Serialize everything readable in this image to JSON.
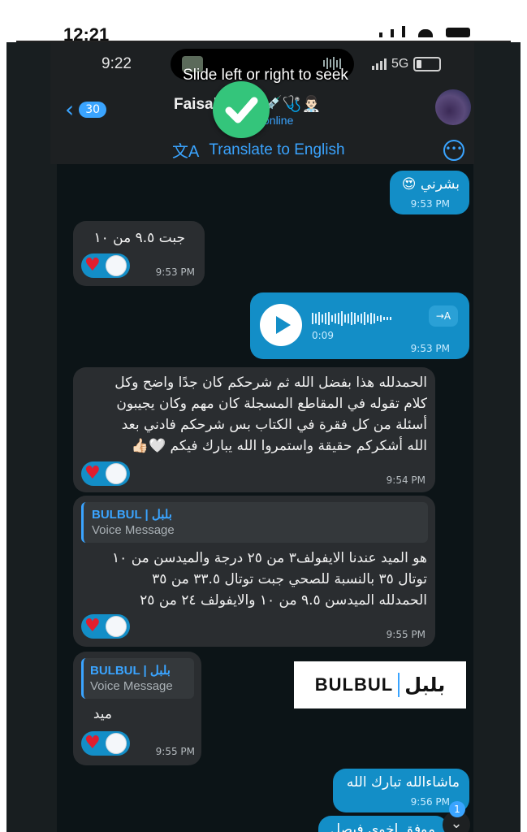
{
  "outer_status": {
    "time": "12:21"
  },
  "inner_status": {
    "time": "9:22",
    "network": "5G"
  },
  "overlay": {
    "seek_hint": "Slide left or right to seek"
  },
  "header": {
    "back_count": "30",
    "contact_name": "Faisal Aldai 💉🩺👨🏻‍⚕️",
    "contact_status": "online",
    "translate_label": "Translate to English"
  },
  "messages": [
    {
      "direction": "out",
      "text": "بشرني 😍",
      "time": "9:53 PM"
    },
    {
      "direction": "in",
      "text": "جبت ٩.٥ من ١٠",
      "time": "9:53 PM"
    },
    {
      "direction": "out",
      "type": "voice",
      "duration": "0:09",
      "transcribe_label": "→A",
      "time": "9:53 PM"
    },
    {
      "direction": "in",
      "lines": [
        "الحمدلله هذا بفضل الله ثم شرحكم كان جدًا واضح وكل",
        "كلام تقوله في المقاطع المسجلة كان مهم وكان يجيبون",
        "أسئلة من كل فقرة في الكتاب بس شرحكم فادني بعد",
        "الله أشكركم حقيقة واستمروا الله يبارك فيكم 🤍👍🏻"
      ],
      "time": "9:54 PM"
    },
    {
      "direction": "in",
      "reply_title": "BULBUL | بلبل",
      "reply_sub": "Voice Message",
      "lines": [
        "هو الميد عندنا الايفولف٣ من ٢٥ درجة والميدسن من ١٠",
        "توتال ٣٥ بالنسبة للصحي جبت توتال ٣٣.٥ من ٣٥",
        "الحمدلله الميدسن ٩.٥ من ١٠ والايفولف ٢٤ من ٢٥"
      ],
      "time": "9:55 PM"
    },
    {
      "direction": "in",
      "reply_title": "BULBUL | بلبل",
      "reply_sub": "Voice Message",
      "text": "ميد",
      "time": "9:55 PM"
    },
    {
      "direction": "out",
      "text": "ماشاءالله تبارك الله",
      "time": "9:56 PM"
    },
    {
      "direction": "out",
      "text": "موفق اخوي فيصل"
    }
  ],
  "brand": {
    "latin": "BULBUL",
    "arabic": "بلبل"
  },
  "scroll_badge": "1",
  "colors": {
    "accent": "#3aa4ff",
    "outgoing": "#138ec7",
    "incoming": "#2a2d30",
    "heart": "#e11d2d"
  }
}
